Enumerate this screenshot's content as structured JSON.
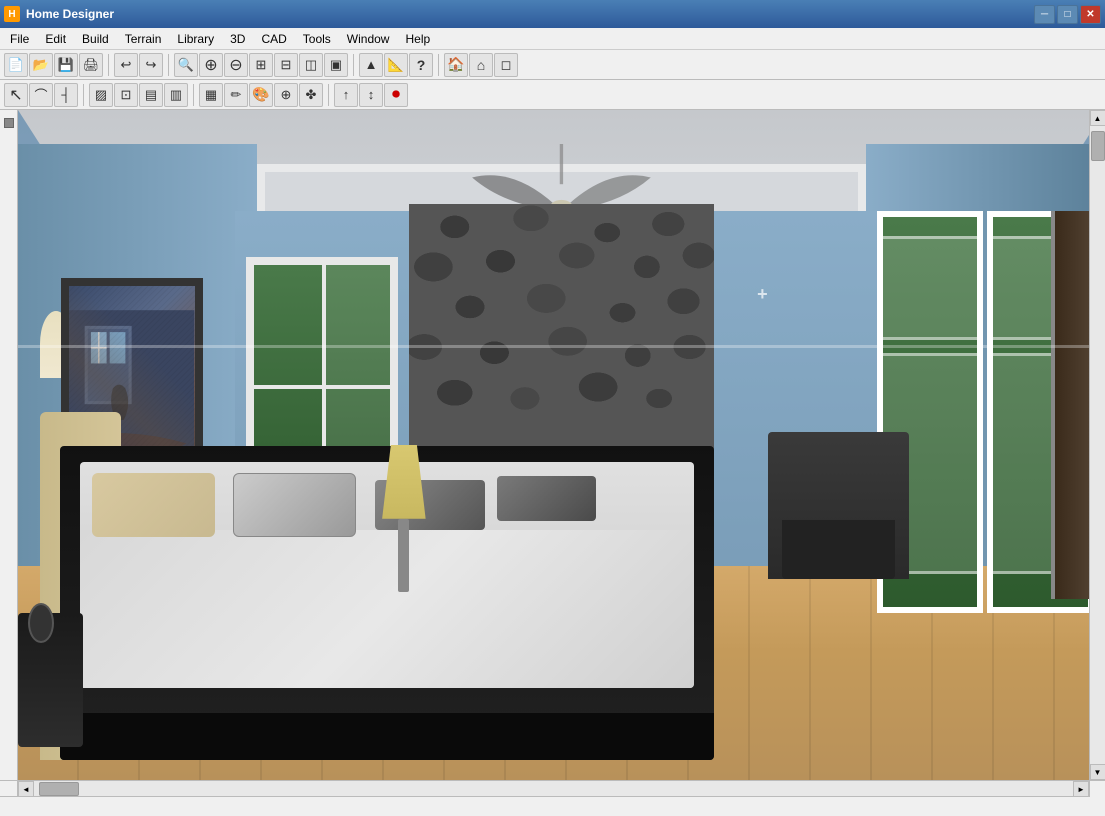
{
  "titlebar": {
    "title": "Home Designer",
    "icon": "H",
    "min_btn": "─",
    "max_btn": "□",
    "close_btn": "✕"
  },
  "menubar": {
    "items": [
      {
        "id": "file",
        "label": "File"
      },
      {
        "id": "edit",
        "label": "Edit"
      },
      {
        "id": "build",
        "label": "Build"
      },
      {
        "id": "terrain",
        "label": "Terrain"
      },
      {
        "id": "library",
        "label": "Library"
      },
      {
        "id": "3d",
        "label": "3D"
      },
      {
        "id": "cad",
        "label": "CAD"
      },
      {
        "id": "tools",
        "label": "Tools"
      },
      {
        "id": "window",
        "label": "Window"
      },
      {
        "id": "help",
        "label": "Help"
      }
    ]
  },
  "toolbar1": {
    "buttons": [
      {
        "id": "new",
        "icon": "📄",
        "tooltip": "New"
      },
      {
        "id": "open",
        "icon": "📂",
        "tooltip": "Open"
      },
      {
        "id": "save",
        "icon": "💾",
        "tooltip": "Save"
      },
      {
        "id": "print",
        "icon": "🖨",
        "tooltip": "Print"
      },
      {
        "id": "undo",
        "icon": "↩",
        "tooltip": "Undo"
      },
      {
        "id": "redo",
        "icon": "↪",
        "tooltip": "Redo"
      },
      {
        "id": "zoom-in-tool",
        "icon": "🔍",
        "tooltip": "Zoom Tools"
      },
      {
        "id": "zoom-in",
        "icon": "⊕",
        "tooltip": "Zoom In"
      },
      {
        "id": "zoom-out",
        "icon": "⊖",
        "tooltip": "Zoom Out"
      },
      {
        "id": "zoom-fit",
        "icon": "⊞",
        "tooltip": "Fit Page"
      },
      {
        "id": "zoom-sel",
        "icon": "⊟",
        "tooltip": "Fit Selection"
      },
      {
        "id": "view-all",
        "icon": "◫",
        "tooltip": "View All"
      },
      {
        "id": "view3d",
        "icon": "▣",
        "tooltip": "3D View"
      },
      {
        "id": "up",
        "icon": "▲",
        "tooltip": "Up"
      },
      {
        "id": "measure",
        "icon": "📐",
        "tooltip": "Measure"
      },
      {
        "id": "help-btn",
        "icon": "?",
        "tooltip": "Help"
      },
      {
        "id": "home3d",
        "icon": "🏠",
        "tooltip": "3D View"
      },
      {
        "id": "roof",
        "icon": "⌂",
        "tooltip": "Roof"
      },
      {
        "id": "floor",
        "icon": "⊟",
        "tooltip": "Floor"
      }
    ]
  },
  "toolbar2": {
    "buttons": [
      {
        "id": "select",
        "icon": "↖",
        "tooltip": "Select"
      },
      {
        "id": "arc",
        "icon": "⌒",
        "tooltip": "Arc"
      },
      {
        "id": "wall",
        "icon": "┤",
        "tooltip": "Wall"
      },
      {
        "id": "door",
        "icon": "▨",
        "tooltip": "Door"
      },
      {
        "id": "window",
        "icon": "⊡",
        "tooltip": "Window"
      },
      {
        "id": "stair",
        "icon": "▤",
        "tooltip": "Stair"
      },
      {
        "id": "room",
        "icon": "▥",
        "tooltip": "Room"
      },
      {
        "id": "cabinet",
        "icon": "▦",
        "tooltip": "Cabinet"
      },
      {
        "id": "paint",
        "icon": "✏",
        "tooltip": "Paint"
      },
      {
        "id": "material",
        "icon": "🎨",
        "tooltip": "Material"
      },
      {
        "id": "fixture",
        "icon": "⊕",
        "tooltip": "Fixture"
      },
      {
        "id": "plant",
        "icon": "✤",
        "tooltip": "Plant"
      },
      {
        "id": "move",
        "icon": "↑",
        "tooltip": "Move"
      },
      {
        "id": "transform",
        "icon": "↕",
        "tooltip": "Transform"
      },
      {
        "id": "record",
        "icon": "⏺",
        "tooltip": "Record"
      }
    ]
  },
  "statusbar": {
    "text": ""
  },
  "scene": {
    "title": "Bedroom 3D View",
    "description": "3D rendered bedroom with fireplace, bed, and french doors"
  }
}
